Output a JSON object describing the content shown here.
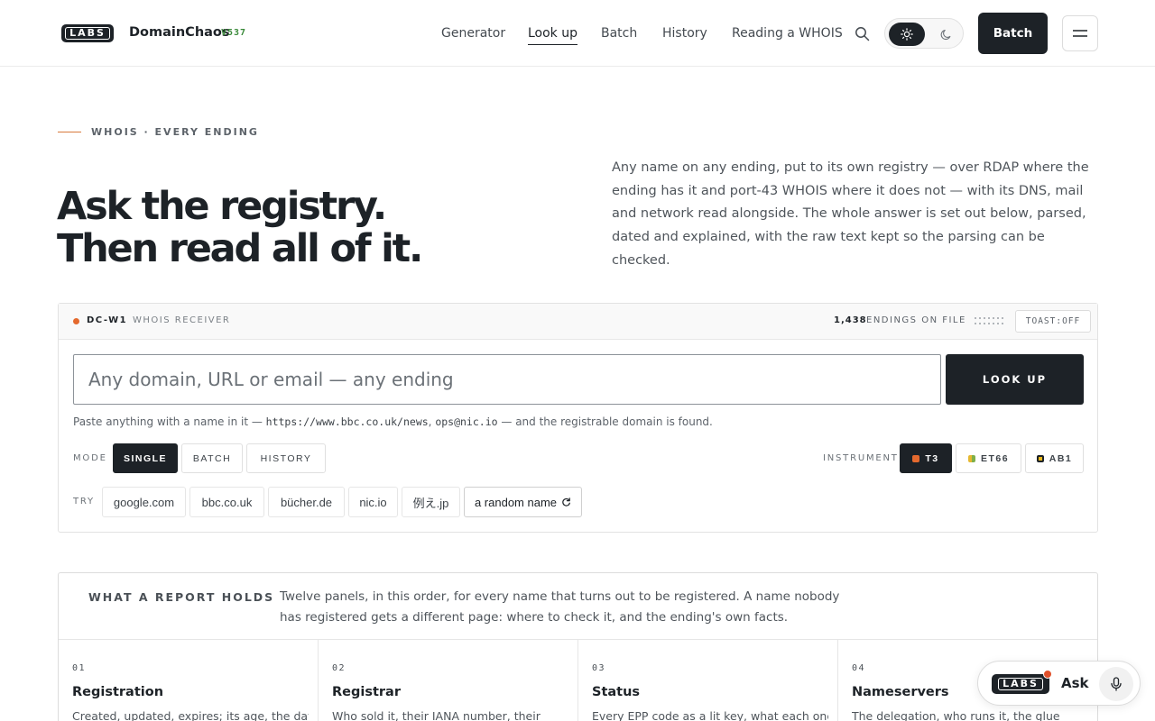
{
  "header": {
    "logo_text": "LABS",
    "brand": "DomainChaos",
    "version": "V537",
    "nav": [
      {
        "label": "Generator"
      },
      {
        "label": "Look up"
      },
      {
        "label": "Batch"
      },
      {
        "label": "History"
      },
      {
        "label": "Reading a WHOIS"
      }
    ],
    "active_nav": "Look up",
    "theme": "light",
    "batch_label": "Batch"
  },
  "hero": {
    "eyebrow": "WHOIS · EVERY ENDING",
    "title_line1": "Ask the registry.",
    "title_line2": "Then read all of it.",
    "description": "Any name on any ending, put to its own registry — over RDAP where the ending has it and port-43 WHOIS where it does not — with its DNS, mail and network read alongside. The whole answer is set out below, parsed, dated and explained, with the raw text kept so the parsing can be checked."
  },
  "receiver": {
    "unit_id": "DC-W1",
    "unit_name": "WHOIS RECEIVER",
    "endings_count": "1,438",
    "endings_label": "ENDINGS ON FILE",
    "toast_label": "TOAST:OFF",
    "input_placeholder": "Any domain, URL or email — any ending",
    "input_value": "",
    "lookup_label": "LOOK UP",
    "hint_prefix": "Paste anything with a name in it — ",
    "hint_url": "https://www.bbc.co.uk/news",
    "hint_sep": ", ",
    "hint_email": "ops@nic.io",
    "hint_suffix": " — and the registrable domain is found.",
    "mode_label": "MODE",
    "modes": [
      {
        "label": "SINGLE"
      },
      {
        "label": "BATCH"
      },
      {
        "label": "HISTORY"
      }
    ],
    "active_mode": "SINGLE",
    "instrument_label": "INSTRUMENT",
    "instruments": [
      {
        "label": "T3",
        "color": "#e4692e"
      },
      {
        "label": "ET66",
        "color": "#a9b94a"
      },
      {
        "label": "AB1",
        "color": "#e8b71c"
      }
    ],
    "active_instrument": "T3",
    "try_label": "TRY",
    "examples": [
      {
        "label": "google.com"
      },
      {
        "label": "bbc.co.uk"
      },
      {
        "label": "bücher.de"
      },
      {
        "label": "nic.io"
      },
      {
        "label": "例え.jp"
      }
    ],
    "random_label": "a random name"
  },
  "report": {
    "title": "WHAT A REPORT HOLDS",
    "description": "Twelve panels, in this order, for every name that turns out to be registered. A name nobody has registered gets a different page: where to check it, and the ending's own facts.",
    "panels": [
      {
        "num": "01",
        "title": "Registration",
        "desc": "Created, updated, expires; its age, the days"
      },
      {
        "num": "02",
        "title": "Registrar",
        "desc": "Who sold it, their IANA number, their"
      },
      {
        "num": "03",
        "title": "Status",
        "desc": "Every EPP code as a lit key, what each one"
      },
      {
        "num": "04",
        "title": "Nameservers",
        "desc": "The delegation, who runs it, the glue"
      }
    ]
  },
  "ask": {
    "logo_text": "LABS",
    "label": "Ask"
  },
  "colors": {
    "ink": "#1d2227",
    "accent_orange": "#e4692e",
    "version_green": "#3a8a3a"
  }
}
